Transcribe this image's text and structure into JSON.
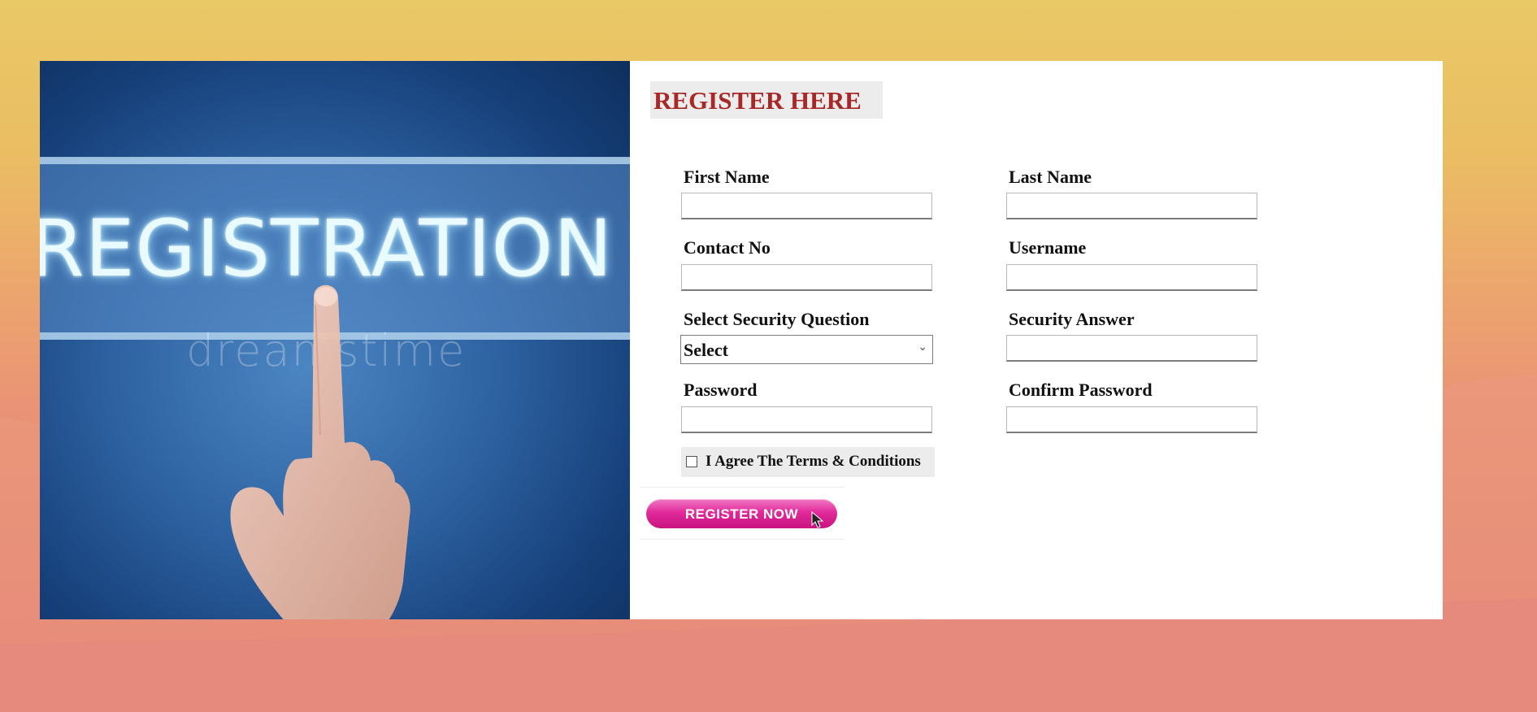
{
  "hero": {
    "banner_text": "REGISTRATION",
    "watermark_text": "dreamstime"
  },
  "form": {
    "title": "REGISTER HERE",
    "first_name": {
      "label": "First Name",
      "value": ""
    },
    "last_name": {
      "label": "Last Name",
      "value": ""
    },
    "contact_no": {
      "label": "Contact No",
      "value": ""
    },
    "username": {
      "label": "Username",
      "value": ""
    },
    "security_question": {
      "label": "Select Security Question",
      "selected": "Select"
    },
    "security_answer": {
      "label": "Security Answer",
      "value": ""
    },
    "password": {
      "label": "Password",
      "value": ""
    },
    "confirm_password": {
      "label": "Confirm Password",
      "value": ""
    },
    "agree": {
      "label": "I Agree The Terms & Conditions",
      "checked": false
    },
    "submit_label": "REGISTER NOW"
  },
  "colors": {
    "title_red": "#a82727",
    "button_pink": "#e12a9b",
    "hero_blue": "#2f64a3"
  }
}
